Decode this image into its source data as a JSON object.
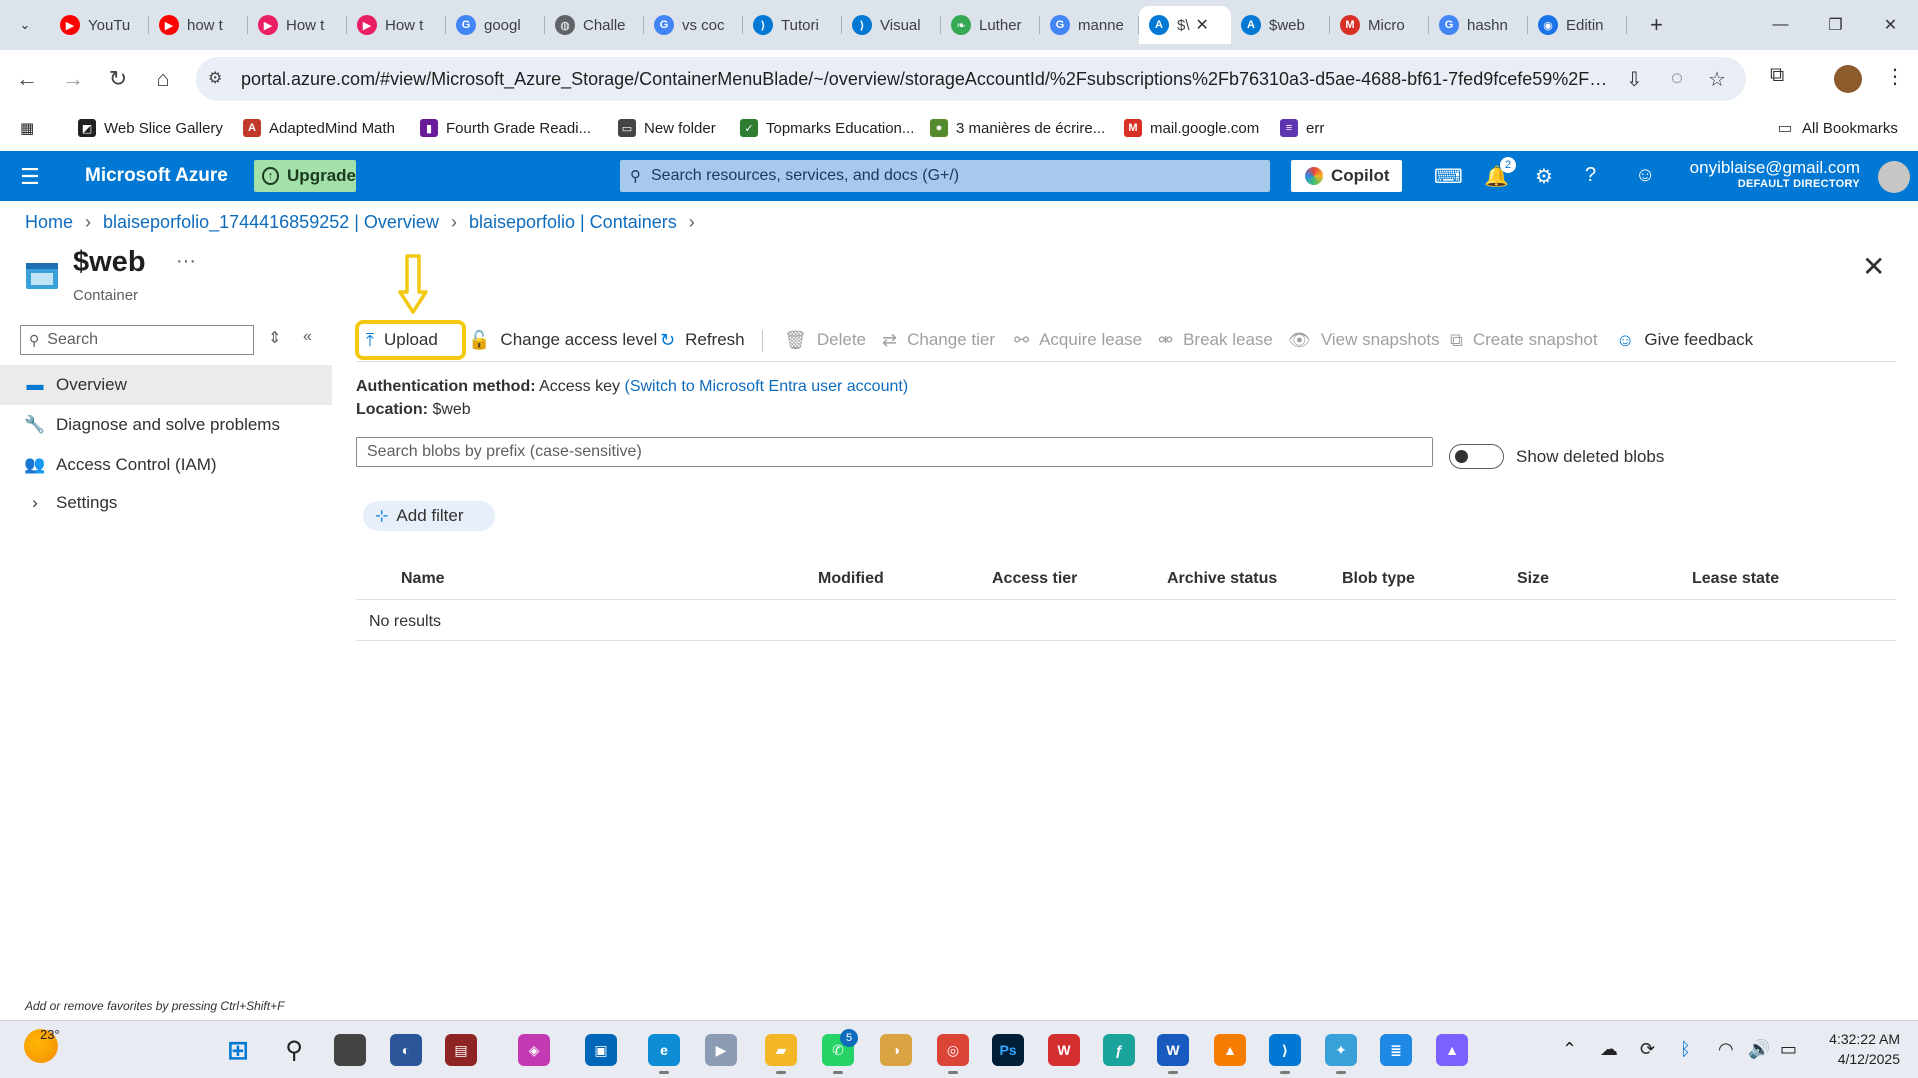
{
  "browser": {
    "tabs": [
      {
        "title": "YouTu",
        "color": "#ff0000",
        "glyph": "▶"
      },
      {
        "title": "how t",
        "color": "#ff0000",
        "glyph": "▶"
      },
      {
        "title": "How t",
        "color": "#e91e63",
        "glyph": "▶"
      },
      {
        "title": "How t",
        "color": "#e91e63",
        "glyph": "▶"
      },
      {
        "title": "googl",
        "color": "#4285f4",
        "glyph": "G"
      },
      {
        "title": "Challe",
        "color": "#5f6368",
        "glyph": "◍"
      },
      {
        "title": "vs coc",
        "color": "#4285f4",
        "glyph": "G"
      },
      {
        "title": "Tutori",
        "color": "#0078d4",
        "glyph": "⟩"
      },
      {
        "title": "Visual",
        "color": "#0078d4",
        "glyph": "⟩"
      },
      {
        "title": "Luther",
        "color": "#34a853",
        "glyph": "❧"
      },
      {
        "title": "manne",
        "color": "#4285f4",
        "glyph": "G"
      },
      {
        "title": "$\\",
        "color": "#0078d4",
        "glyph": "A",
        "active": true
      },
      {
        "title": "$web",
        "color": "#0078d4",
        "glyph": "A"
      },
      {
        "title": "Micro",
        "color": "#d93025",
        "glyph": "M"
      },
      {
        "title": "hashn",
        "color": "#4285f4",
        "glyph": "G"
      },
      {
        "title": "Editin",
        "color": "#1a73e8",
        "glyph": "◉"
      }
    ],
    "url": "portal.azure.com/#view/Microsoft_Azure_Storage/ContainerMenuBlade/~/overview/storageAccountId/%2Fsubscriptions%2Fb76310a3-d5ae-4688-bf61-7fed9fcefe59%2Fresour...",
    "bookmarks": [
      {
        "label": "Web Slice Gallery",
        "color": "#222222",
        "glyph": "◩"
      },
      {
        "label": "AdaptedMind Math",
        "color": "#c0392b",
        "glyph": "A"
      },
      {
        "label": "Fourth Grade Readi...",
        "color": "#6a1b9a",
        "glyph": "▮"
      },
      {
        "label": "New folder",
        "color": "#444444",
        "glyph": "▭"
      },
      {
        "label": "Topmarks Education...",
        "color": "#2e7d32",
        "glyph": "✓"
      },
      {
        "label": "3 manières de écrire...",
        "color": "#558b2f",
        "glyph": "●"
      },
      {
        "label": "mail.google.com",
        "color": "#d93025",
        "glyph": "M"
      },
      {
        "label": "err",
        "color": "#5e35b1",
        "glyph": "≡"
      }
    ],
    "all_bookmarks": "All Bookmarks"
  },
  "azure": {
    "brand": "Microsoft Azure",
    "upgrade": "Upgrade",
    "search_placeholder": "Search resources, services, and docs (G+/)",
    "copilot": "Copilot",
    "notification_count": "2",
    "user_email": "onyiblaise@gmail.com",
    "directory": "DEFAULT DIRECTORY"
  },
  "breadcrumb": [
    "Home",
    "blaiseporfolio_1744416859252 | Overview",
    "blaiseporfolio | Containers"
  ],
  "resource": {
    "title": "$web",
    "subtitle": "Container",
    "more": "···"
  },
  "sidenav": {
    "search_placeholder": "Search",
    "items": [
      {
        "label": "Overview",
        "icon": "overview-icon",
        "glyph": "▬",
        "active": true
      },
      {
        "label": "Diagnose and solve problems",
        "icon": "wrench-icon",
        "glyph": "🔧"
      },
      {
        "label": "Access Control (IAM)",
        "icon": "people-icon",
        "glyph": "👥"
      },
      {
        "label": "Settings",
        "icon": "chevron-right-icon",
        "glyph": "›"
      }
    ]
  },
  "commands": {
    "upload": "Upload",
    "change_access": "Change access level",
    "refresh": "Refresh",
    "delete": "Delete",
    "change_tier": "Change tier",
    "acquire_lease": "Acquire lease",
    "break_lease": "Break lease",
    "view_snapshots": "View snapshots",
    "create_snapshot": "Create snapshot",
    "give_feedback": "Give feedback"
  },
  "content": {
    "auth_label": "Authentication method:",
    "auth_value": "Access key",
    "auth_link": "(Switch to Microsoft Entra user account)",
    "location_label": "Location:",
    "location_value": "$web",
    "blob_search_placeholder": "Search blobs by prefix (case-sensitive)",
    "show_deleted": "Show deleted blobs",
    "add_filter": "Add filter",
    "columns": [
      "Name",
      "Modified",
      "Access tier",
      "Archive status",
      "Blob type",
      "Size",
      "Lease state"
    ],
    "no_results": "No results"
  },
  "favorites_hint": "Add or remove favorites by pressing Ctrl+Shift+F",
  "taskbar": {
    "temperature": "23°",
    "time": "4:32:22 AM",
    "date": "4/12/2025",
    "whatsapp_badge": "5"
  },
  "colors": {
    "accent": "#0078d4",
    "highlight": "#f2c811"
  }
}
